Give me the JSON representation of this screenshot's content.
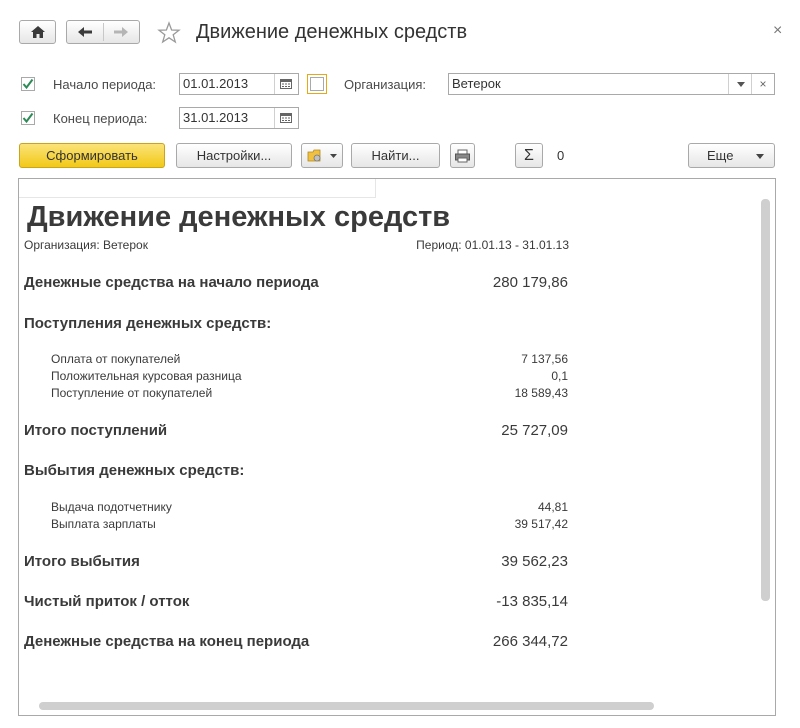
{
  "window": {
    "title": "Движение денежных средств",
    "close_glyph": "×"
  },
  "icons": {
    "home": "home-icon",
    "back": "back-arrow-icon",
    "forward": "forward-arrow-icon",
    "favorite": "star-icon",
    "calendar": "calendar-icon",
    "dropdown": "chevron-down-icon",
    "clear": "clear-icon",
    "variant": "report-variant-icon",
    "print": "printer-icon",
    "sum": "sigma-icon"
  },
  "filters": {
    "period_start": {
      "label": "Начало периода:",
      "value": "01.01.2013",
      "checked": true
    },
    "period_end": {
      "label": "Конец периода:",
      "value": "31.01.2013",
      "checked": true
    },
    "organization": {
      "label": "Организация:",
      "value": "Ветерок",
      "checked": false,
      "clear_glyph": "×"
    }
  },
  "toolbar": {
    "generate_label": "Сформировать",
    "settings_label": "Настройки...",
    "find_label": "Найти...",
    "sum_glyph": "Σ",
    "sum_value": "0",
    "more_label": "Еще"
  },
  "colors": {
    "accent_button": "#f5d23a",
    "checkmark": "#2e8b57",
    "border": "#a9a9a9"
  },
  "report": {
    "title": "Движение денежных средств",
    "organization_line": "Организация: Ветерок",
    "period_line": "Период: 01.01.13 - 31.01.13",
    "opening_balance": {
      "label": "Денежные средства на начало периода",
      "value": "280 179,86"
    },
    "receipts_header": "Поступления денежных средств:",
    "receipts": [
      {
        "label": "Оплата от покупателей",
        "value": "7 137,56"
      },
      {
        "label": "Положительная курсовая разница",
        "value": "0,1"
      },
      {
        "label": "Поступление от покупателей",
        "value": "18 589,43"
      }
    ],
    "receipts_total": {
      "label": "Итого поступлений",
      "value": "25 727,09"
    },
    "disbursements_header": "Выбытия денежных средств:",
    "disbursements": [
      {
        "label": "Выдача подотчетнику",
        "value": "44,81"
      },
      {
        "label": "Выплата зарплаты",
        "value": "39 517,42"
      }
    ],
    "disbursements_total": {
      "label": "Итого выбытия",
      "value": "39 562,23"
    },
    "net_flow": {
      "label": "Чистый приток / отток",
      "value": "-13 835,14"
    },
    "closing_balance": {
      "label": "Денежные средства на конец периода",
      "value": "266 344,72"
    }
  }
}
